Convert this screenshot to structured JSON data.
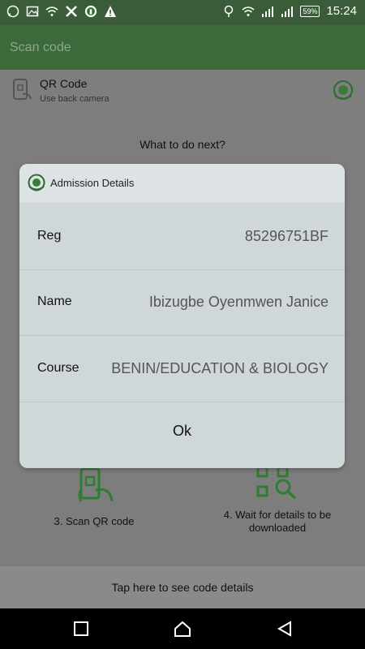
{
  "status_bar": {
    "time": "15:24",
    "battery": "59%",
    "left_icons": [
      "whatsapp-icon",
      "image-icon",
      "wifi-icon",
      "x-icon",
      "vpn-icon",
      "warning-icon"
    ],
    "right_icons": [
      "location-icon",
      "wifi-icon",
      "signal-icon",
      "signal-icon",
      "battery-icon"
    ]
  },
  "app_bar": {
    "title": "Scan code"
  },
  "qr_option": {
    "title": "QR Code",
    "subtitle": "Use back camera"
  },
  "main": {
    "prompt": "What to do next?",
    "steps": [
      {
        "label": "3. Scan QR code",
        "icon": "phone-scan-icon"
      },
      {
        "label": "4. Wait for details to be downloaded",
        "icon": "qr-search-icon"
      }
    ],
    "bottom_action": "Tap here to see code details"
  },
  "dialog": {
    "title": "Admission Details",
    "rows": [
      {
        "label": "Reg",
        "value": "85296751BF"
      },
      {
        "label": "Name",
        "value": "Ibizugbe Oyenmwen Janice"
      },
      {
        "label": "Course",
        "value": "BENIN/EDUCATION & BIOLOGY"
      }
    ],
    "ok_label": "Ok"
  },
  "colors": {
    "accent": "#3c6a3a",
    "icon_green": "#2e7d32"
  }
}
